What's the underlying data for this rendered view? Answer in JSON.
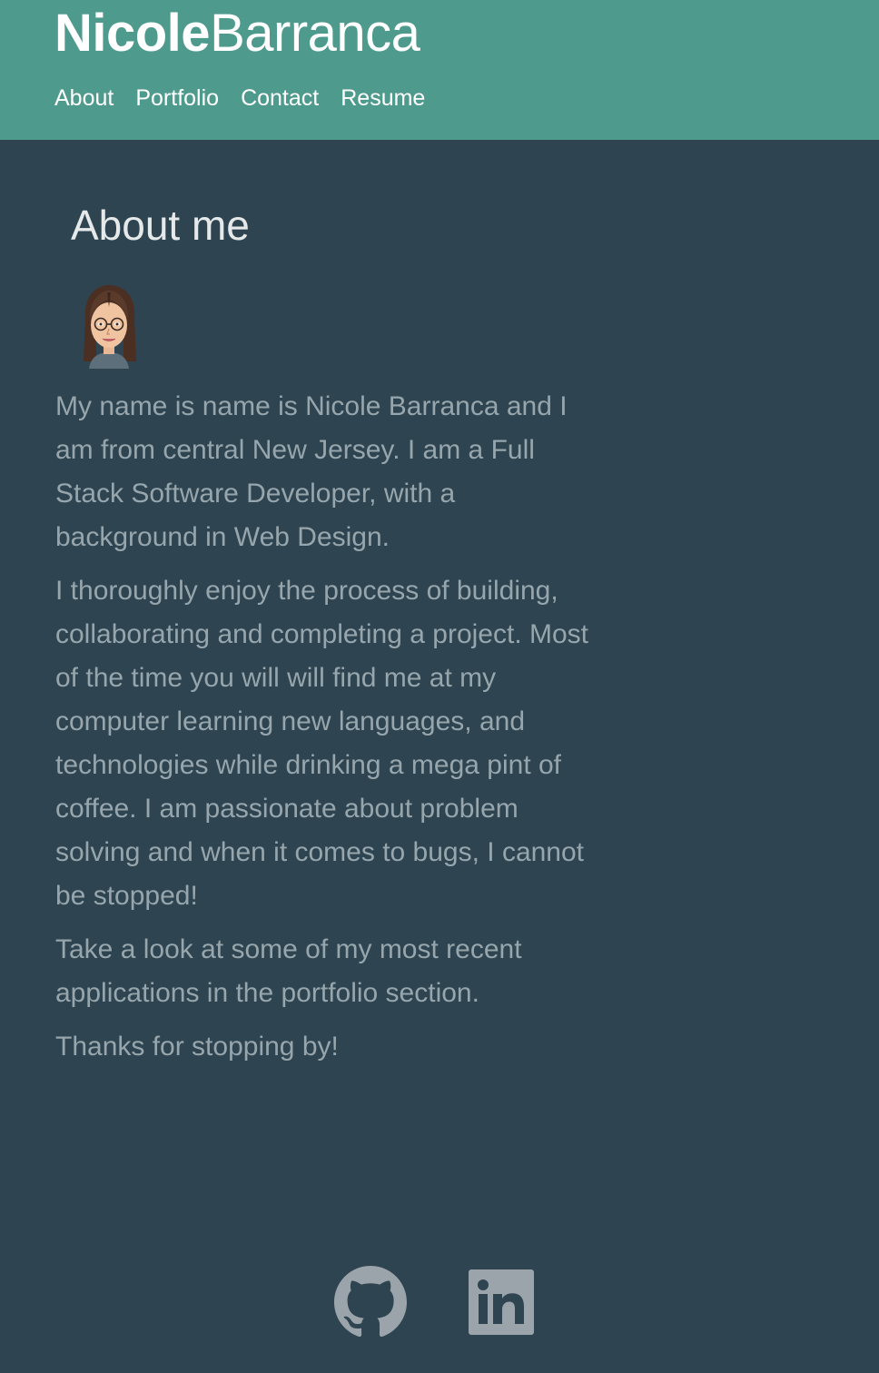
{
  "header": {
    "brand_first": "Nicole",
    "brand_last": "Barranca",
    "nav": [
      {
        "label": "About"
      },
      {
        "label": "Portfolio"
      },
      {
        "label": "Contact"
      },
      {
        "label": "Resume"
      }
    ]
  },
  "main": {
    "title": "About me",
    "paragraphs": [
      "My name is name is Nicole Barranca and I am from central New Jersey. I am a Full Stack Software Developer, with a background in Web Design.",
      "I thoroughly enjoy the process of building, collaborating and completing a project. Most of the time you will will find me at my computer learning new languages, and technologies while drinking a mega pint of coffee. I am passionate about problem solving and when it comes to bugs, I cannot be stopped!",
      "Take a look at some of my most recent applications in the portfolio section.",
      "Thanks for stopping by!"
    ]
  },
  "footer": {
    "icons": [
      "github-icon",
      "linkedin-icon"
    ]
  },
  "colors": {
    "header_bg": "#4e9b8e",
    "page_bg": "#2e4450",
    "body_text": "#97a6ad",
    "icon": "#9aa4aa"
  }
}
